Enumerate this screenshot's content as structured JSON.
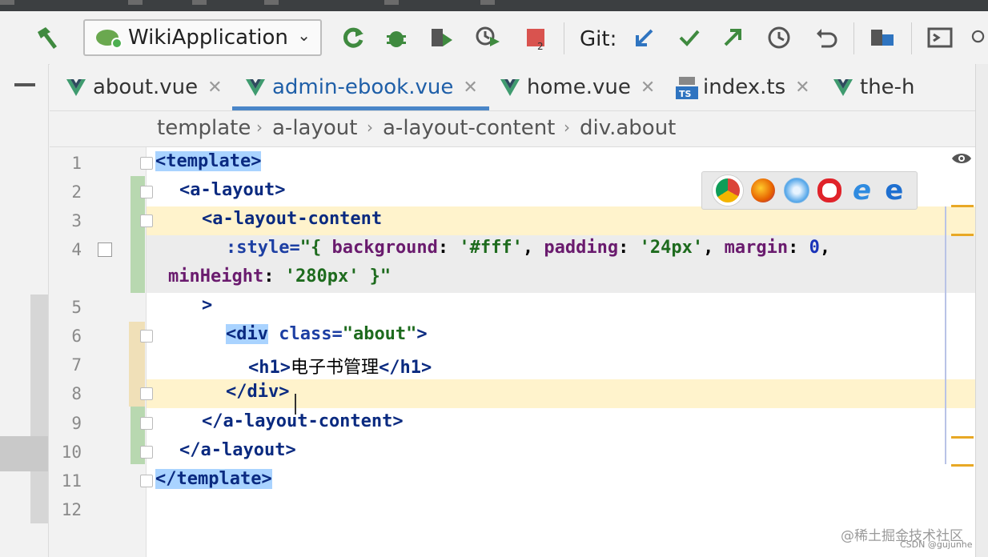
{
  "toolbar": {
    "run_config_label": "WikiApplication",
    "git_label": "Git:",
    "stop_badge": "2"
  },
  "tabs": [
    {
      "label": "about.vue",
      "icon": "vue-icon"
    },
    {
      "label": "admin-ebook.vue",
      "icon": "vue-icon",
      "active": true
    },
    {
      "label": "home.vue",
      "icon": "vue-icon"
    },
    {
      "label": "index.ts",
      "icon": "typescript-icon"
    },
    {
      "label": "the-h",
      "icon": "vue-icon"
    }
  ],
  "breadcrumb": [
    "template",
    "a-layout",
    "a-layout-content",
    "div.about"
  ],
  "line_numbers": [
    "1",
    "2",
    "3",
    "4",
    "5",
    "6",
    "7",
    "8",
    "9",
    "10",
    "11",
    "12"
  ],
  "code": {
    "l1": "<template>",
    "l2": "<a-layout>",
    "l3": "<a-layout-content",
    "l4_attr": ":style=",
    "l4_open": "\"{ ",
    "l4_bg_key": "background",
    "l4_bg_val": "'#fff'",
    "l4_pad_key": "padding",
    "l4_pad_val": "'24px'",
    "l4_margin_key": "margin",
    "l4_margin_val": "0",
    "l4w_key": "minHeight",
    "l4w_val": "'280px'",
    "l4w_close": " }\"",
    "l5": ">",
    "l6_open": "<div",
    "l6_attr": " class=",
    "l6_val": "\"about\"",
    "l6_close": ">",
    "l7_open": "<h1>",
    "l7_text": "电子书管理",
    "l7_close": "</h1>",
    "l8": "</div>",
    "l9": "</a-layout-content>",
    "l10": "</a-layout>",
    "l11": "</template>"
  },
  "watermark": {
    "line1": "@稀土掘金技术社区",
    "line2": "CSDN @gujunhe"
  },
  "colors": {
    "accent": "#4a86c8",
    "tag": "#0a2a80",
    "string": "#1e6b1e",
    "key": "#6a1b6e"
  }
}
